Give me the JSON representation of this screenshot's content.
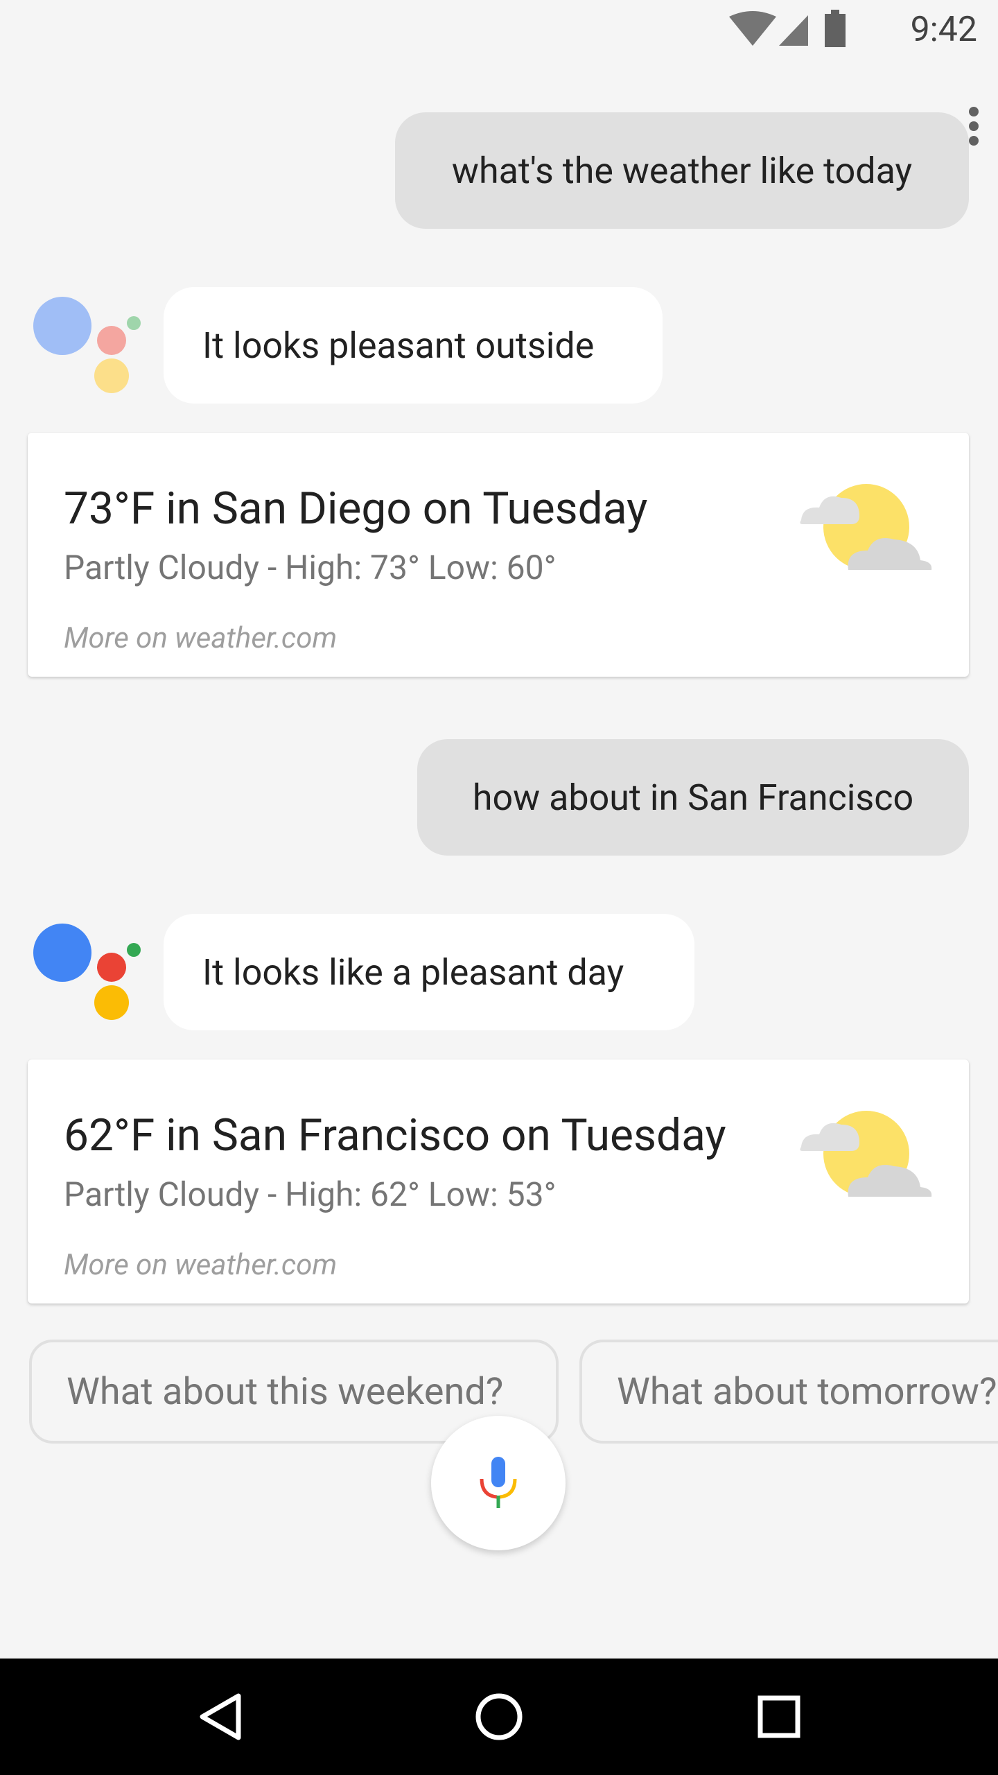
{
  "status_bar": {
    "time": "9:42"
  },
  "conversation": {
    "query1": "what's the weather like today",
    "response1": "It looks pleasant outside",
    "card1": {
      "title": "73°F in San Diego on Tuesday",
      "subtitle": "Partly Cloudy - High: 73° Low: 60°",
      "link": "More on weather.com"
    },
    "query2": "how about in San Francisco",
    "response2": "It looks like a pleasant day",
    "card2": {
      "title": "62°F in San Francisco on Tuesday",
      "subtitle": "Partly Cloudy - High: 62° Low: 53°",
      "link": "More on weather.com"
    }
  },
  "suggestions": [
    "What about this weekend?",
    "What about tomorrow?"
  ],
  "colors": {
    "blue": "#4285f4",
    "red": "#ea4335",
    "yellow": "#fbbc05",
    "green": "#34a853"
  },
  "icons": {
    "weather": "partly-cloudy-icon",
    "mic": "mic-icon",
    "nav_back": "back-triangle-icon",
    "nav_home": "home-circle-icon",
    "nav_recents": "recents-square-icon"
  }
}
